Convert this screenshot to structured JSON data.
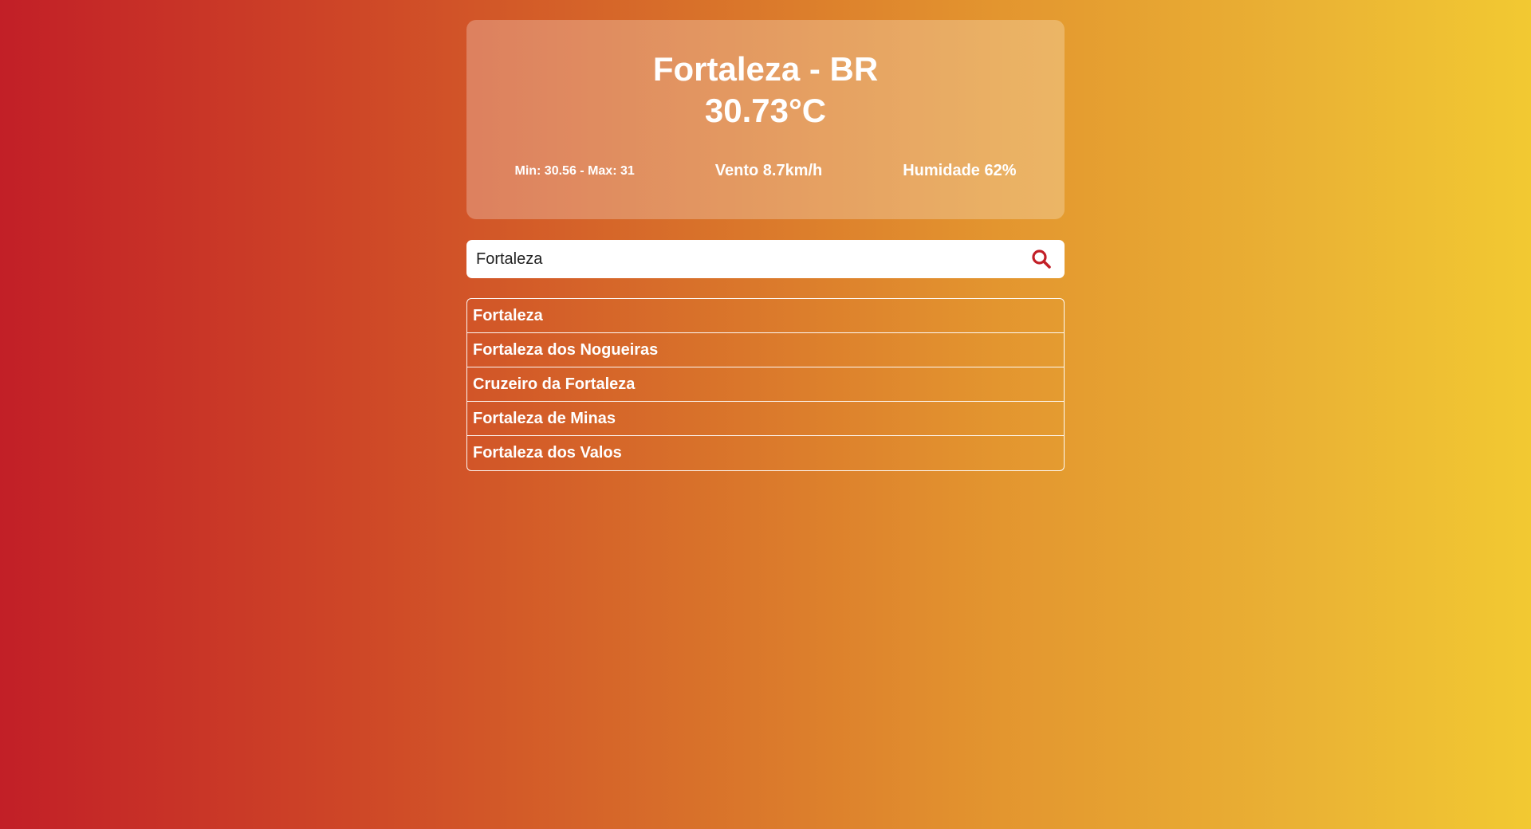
{
  "weather": {
    "city": "Fortaleza - BR",
    "temperature": "30.73°C",
    "minmax": "Min: 30.56 - Max: 31",
    "wind": "Vento 8.7km/h",
    "humidity": "Humidade 62%"
  },
  "search": {
    "value": "Fortaleza",
    "icon": "search-icon",
    "icon_color": "#c21f27"
  },
  "suggestions": [
    {
      "label": "Fortaleza"
    },
    {
      "label": "Fortaleza dos Nogueiras"
    },
    {
      "label": "Cruzeiro da Fortaleza"
    },
    {
      "label": "Fortaleza de Minas"
    },
    {
      "label": "Fortaleza dos Valos"
    }
  ]
}
